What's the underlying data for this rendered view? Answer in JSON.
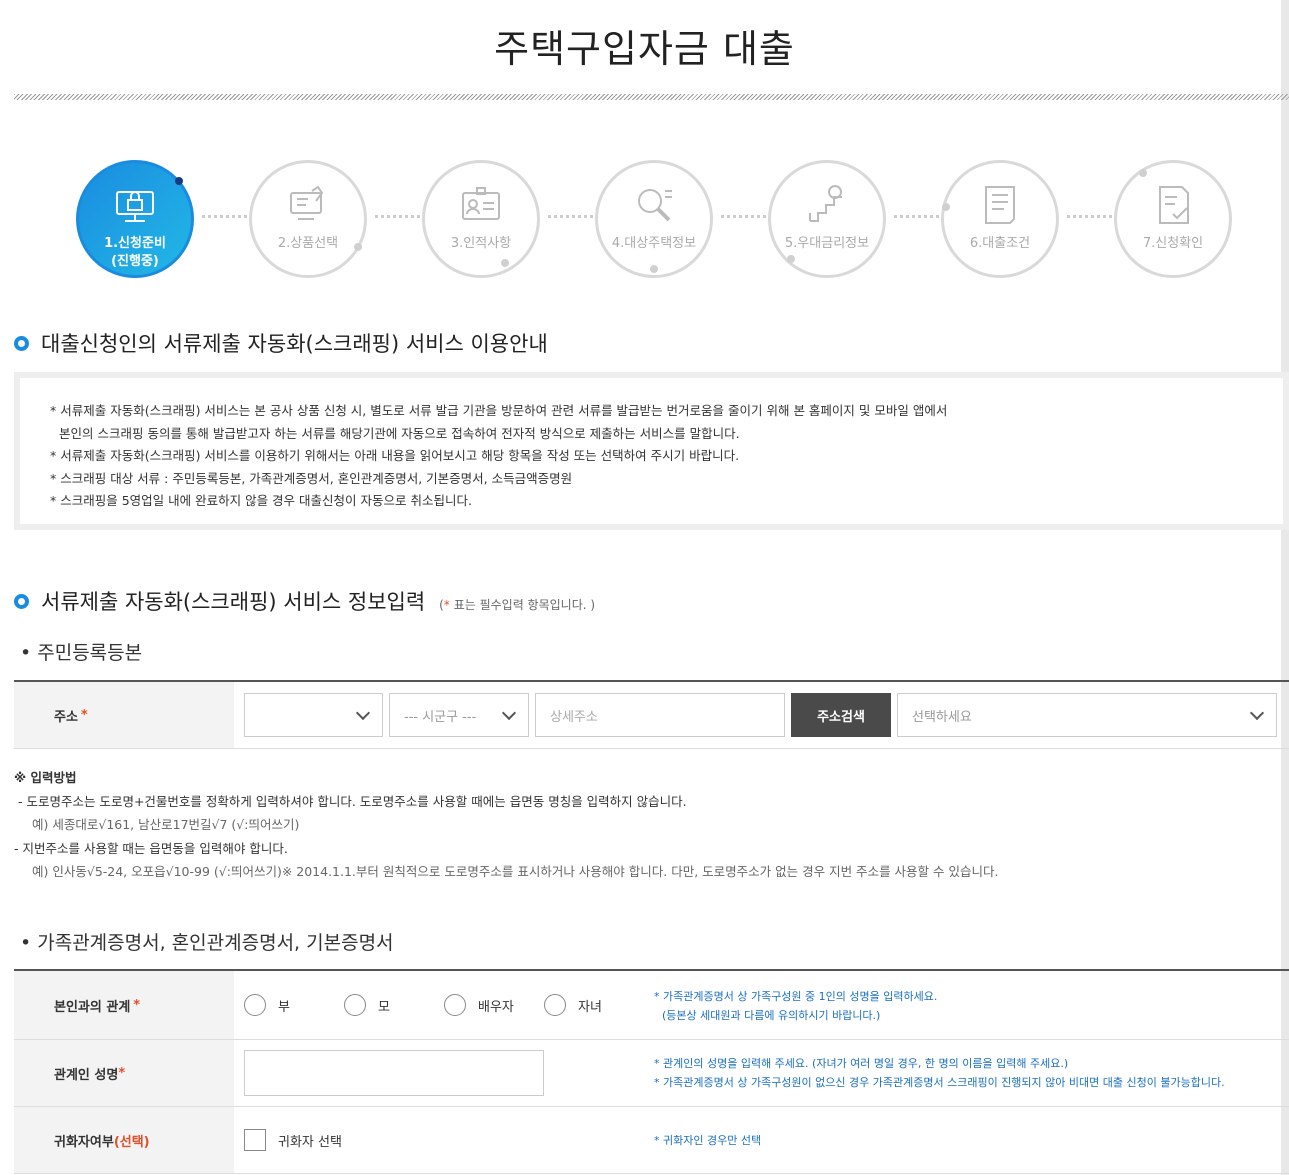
{
  "page": {
    "title": "주택구입자금 대출"
  },
  "steps": [
    {
      "label": "1.신청준비",
      "sub": "(진행중)",
      "icon": "monitor-lock-icon",
      "active": true
    },
    {
      "label": "2.상품선택",
      "icon": "computer-hand-icon"
    },
    {
      "label": "3.인적사항",
      "icon": "id-card-icon"
    },
    {
      "label": "4.대상주택정보",
      "icon": "magnifier-icon"
    },
    {
      "label": "5.우대금리정보",
      "icon": "stairs-coin-icon"
    },
    {
      "label": "6.대출조건",
      "icon": "document-list-icon"
    },
    {
      "label": "7.신청확인",
      "icon": "document-check-icon"
    }
  ],
  "notice": {
    "title": "대출신청인의 서류제출 자동화(스크래핑) 서비스 이용안내",
    "lines": [
      "* 서류제출 자동화(스크래핑) 서비스는 본 공사 상품 신청 시, 별도로 서류 발급 기관을 방문하여 관련 서류를 발급받는 번거로움을 줄이기 위해 본 홈페이지 및 모바일 앱에서",
      "   본인의 스크래핑 동의를 통해 발급받고자 하는 서류를 해당기관에 자동으로 접속하여 전자적 방식으로 제출하는 서비스를 말합니다.",
      "* 서류제출 자동화(스크래핑) 서비스를 이용하기 위해서는 아래 내용을 읽어보시고 해당 항목을 작성 또는 선택하여 주시기 바랍니다.",
      "* 스크래핑 대상 서류 : 주민등록등본, 가족관계증명서, 혼인관계증명서, 기본증명서, 소득금액증명원",
      "* 스크래핑을 5영업일 내에 완료하지 않을 경우 대출신청이 자동으로 취소됩니다."
    ]
  },
  "form_section": {
    "title": "서류제출 자동화(스크래핑) 서비스 정보입력",
    "required_star": "*",
    "required_note": "표는 필수입력 항목입니다. )",
    "required_note_open": "("
  },
  "resident": {
    "title": "• 주민등록등본",
    "address_label": "주소",
    "sido_value": "",
    "sigungu_placeholder": "--- 시군구 ---",
    "detail_placeholder": "상세주소",
    "search_button": "주소검색",
    "result_placeholder": "선택하세요"
  },
  "guide": {
    "heading": "※ 입력방법",
    "line1": "- 도로명주소는 도로명+건물번호를 정확하게 입력하셔야 합니다. 도로명주소를 사용할 때에는 읍면동 명칭을 입력하지 않습니다.",
    "ex1": "예) 세종대로√161, 남산로17번길√7 (√:띄어쓰기)",
    "line2": "- 지번주소를 사용할 때는 읍면동을 입력해야 합니다.",
    "ex2": "예) 인사동√5-24, 오포읍√10-99 (√:띄어쓰기)※ 2014.1.1.부터 원칙적으로 도로명주소를 표시하거나 사용해야 합니다. 다만, 도로명주소가 없는 경우 지번 주소를 사용할 수 있습니다."
  },
  "family": {
    "title": "• 가족관계증명서, 혼인관계증명서, 기본증명서",
    "relation_label": "본인과의 관계",
    "relations": [
      "부",
      "모",
      "배우자",
      "자녀"
    ],
    "relation_hint1": "* 가족관계증명서 상 가족구성원 중 1인의 성명을 입력하세요.",
    "relation_hint2": "(등본상 세대원과 다름에 유의하시기 바랍니다.)",
    "name_label": "관계인 성명",
    "name_value": "",
    "name_hint1": "* 관계인의 성명을 입력해 주세요. (자녀가 여러 명일 경우, 한 명의 이름을 입력해 주세요.)",
    "name_hint2": "* 가족관계증명서 상 가족구성원이 없으신 경우 가족관계증명서 스크래핑이 진행되지 않아 비대면 대출 신청이 불가능합니다.",
    "naturalized_label": "귀화자여부",
    "naturalized_opt": "(선택)",
    "naturalized_check": "귀화자 선택",
    "naturalized_hint": "*  귀화자인 경우만 선택"
  }
}
